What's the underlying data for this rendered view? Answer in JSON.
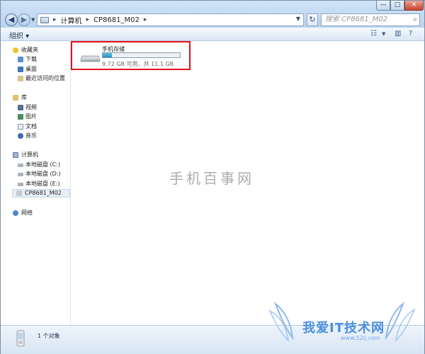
{
  "window": {
    "buttons": {
      "minimize": "—",
      "maximize": "□",
      "close": "✕"
    }
  },
  "address": {
    "crumbs": [
      "计算机",
      "CP8681_M02"
    ]
  },
  "search": {
    "placeholder": "搜索 CP8681_M02"
  },
  "toolbar": {
    "organize": "组织 ▾"
  },
  "sidebar": {
    "favorites": "收藏夹",
    "fav_items": [
      "下载",
      "桌面",
      "最近访问的位置"
    ],
    "libraries": "库",
    "lib_items": [
      "视频",
      "图片",
      "文档",
      "音乐"
    ],
    "computer": "计算机",
    "comp_items": [
      "本地磁盘 (C:)",
      "本地磁盘 (D:)",
      "本地磁盘 (E:)",
      "CP8681_M02"
    ],
    "network": "网络"
  },
  "device": {
    "name": "手机存储",
    "free_text": "9.72 GB 可用，共 11.1 GB",
    "used_fraction": 0.12,
    "highlight_color": "#e2121c"
  },
  "watermark": {
    "text": "手机百事网"
  },
  "status": {
    "text": "1 个对象"
  },
  "logo": {
    "main": "我爱IT技术网",
    "url": "www.52ij.com"
  },
  "icons": [
    "back-icon",
    "forward-icon",
    "computer-icon",
    "refresh-icon",
    "search-icon",
    "view-icon",
    "preview-pane-icon",
    "help-icon",
    "star-icon",
    "folder-icon",
    "library-icon",
    "video-icon",
    "picture-icon",
    "document-icon",
    "music-icon",
    "disk-icon",
    "usb-drive-icon",
    "network-icon",
    "phone-icon"
  ]
}
